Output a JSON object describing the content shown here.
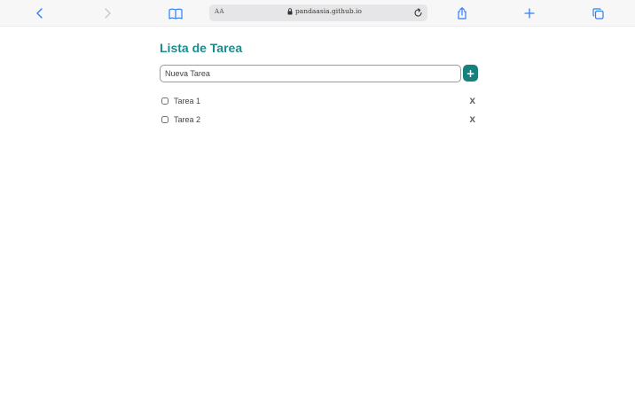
{
  "browser": {
    "text_size_label": "AA",
    "url": "pandaasia.github.io"
  },
  "app": {
    "title": "Lista de Tarea",
    "new_task_placeholder": "Nueva Tarea",
    "add_label": "+",
    "tasks": [
      {
        "label": "Tarea 1",
        "checked": false,
        "delete_label": "x"
      },
      {
        "label": "Tarea 2",
        "checked": false,
        "delete_label": "x"
      }
    ]
  },
  "colors": {
    "accent": "#1a8c8c",
    "add_button": "#16807d",
    "toolbar_icon": "#2f7ef6"
  }
}
